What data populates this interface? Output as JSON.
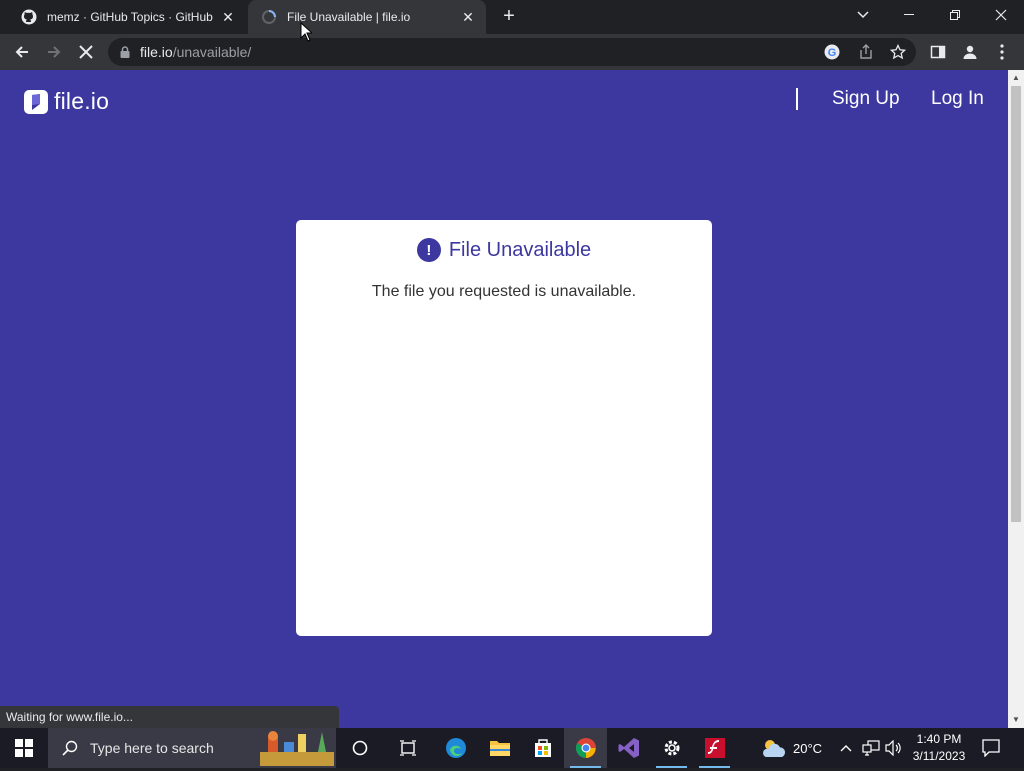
{
  "browser": {
    "tabs": [
      {
        "title": "memz · GitHub Topics · GitHub",
        "icon": "github-icon",
        "active": false
      },
      {
        "title": "File Unavailable | file.io",
        "icon": "loading-icon",
        "active": true
      }
    ],
    "new_tab_label": "+",
    "url_host": "file.io",
    "url_path": "/unavailable/",
    "status_text": "Waiting for www.file.io..."
  },
  "site": {
    "logo_text": "file.io",
    "nav": {
      "signup": "Sign Up",
      "login": "Log In"
    },
    "card": {
      "heading": "File Unavailable",
      "alert_glyph": "!",
      "message": "The file you requested is unavailable."
    },
    "colors": {
      "brand": "#3d389f"
    }
  },
  "taskbar": {
    "search_placeholder": "Type here to search",
    "weather_temp": "20°C",
    "time": "1:40 PM",
    "date": "3/11/2023"
  }
}
